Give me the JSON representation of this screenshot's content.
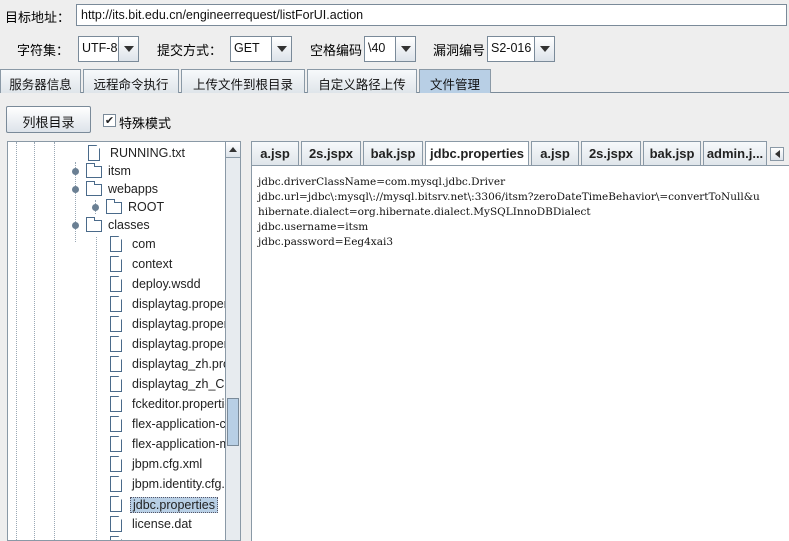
{
  "form": {
    "target_label": "目标地址：",
    "target_url": "http://its.bit.edu.cn/engineerrequest/listForUI.action",
    "charset_label": "字符集：",
    "charset_value": "UTF-8",
    "method_label": "提交方式：",
    "method_value": "GET",
    "space_label": "空格编码",
    "space_value": "\\40",
    "vuln_label": "漏洞编号",
    "vuln_value": "S2-016"
  },
  "tabs": [
    "服务器信息",
    "远程命令执行",
    "上传文件到根目录",
    "自定义路径上传",
    "文件管理"
  ],
  "active_tab": "文件管理",
  "toolbar": {
    "list_root_label": "列根目录",
    "special_mode_label": "特殊模式",
    "special_mode_checked": true,
    "check_mark": "✔"
  },
  "tree": [
    {
      "label": "RUNNING.txt",
      "type": "file"
    },
    {
      "label": "itsm",
      "type": "folder",
      "expander": "collapsed"
    },
    {
      "label": "webapps",
      "type": "folder",
      "expander": "expanded"
    },
    {
      "label": "ROOT",
      "type": "folder",
      "expander": "collapsed"
    },
    {
      "label": "classes",
      "type": "folder",
      "expander": "expanded"
    },
    {
      "label": "com",
      "type": "file"
    },
    {
      "label": "context",
      "type": "file"
    },
    {
      "label": "deploy.wsdd",
      "type": "file"
    },
    {
      "label": "displaytag.propert",
      "type": "file"
    },
    {
      "label": "displaytag.propert",
      "type": "file"
    },
    {
      "label": "displaytag.propert",
      "type": "file"
    },
    {
      "label": "displaytag_zh.pro",
      "type": "file"
    },
    {
      "label": "displaytag_zh_CN",
      "type": "file"
    },
    {
      "label": "fckeditor.propertie",
      "type": "file"
    },
    {
      "label": "flex-application-co",
      "type": "file"
    },
    {
      "label": "flex-application-m",
      "type": "file"
    },
    {
      "label": "jbpm.cfg.xml",
      "type": "file"
    },
    {
      "label": "jbpm.identity.cfg.x",
      "type": "file"
    },
    {
      "label": "jdbc.properties",
      "type": "file",
      "selected": true
    },
    {
      "label": "license.dat",
      "type": "file"
    },
    {
      "label": "",
      "type": "file"
    }
  ],
  "file_tabs": [
    "a.jsp",
    "2s.jspx",
    "bak.jsp",
    "jdbc.properties",
    "a.jsp",
    "2s.jspx",
    "bak.jsp",
    "admin.j..."
  ],
  "active_file_tab": "jdbc.properties",
  "file_content": [
    "jdbc.driverClassName=com.mysql.jdbc.Driver",
    "jdbc.url=jdbc\\:mysql\\://mysql.bitsrv.net\\:3306/itsm?zeroDateTimeBehavior\\=convertToNull&u",
    "hibernate.dialect=org.hibernate.dialect.MySQLInnoDBDialect",
    "jdbc.username=itsm",
    "jdbc.password=Eeg4xai3"
  ],
  "colors": {
    "background": "#eeeeee",
    "active_tab": "#b8cfe5",
    "selection": "#b8cfe5",
    "border": "#7a8a99"
  }
}
